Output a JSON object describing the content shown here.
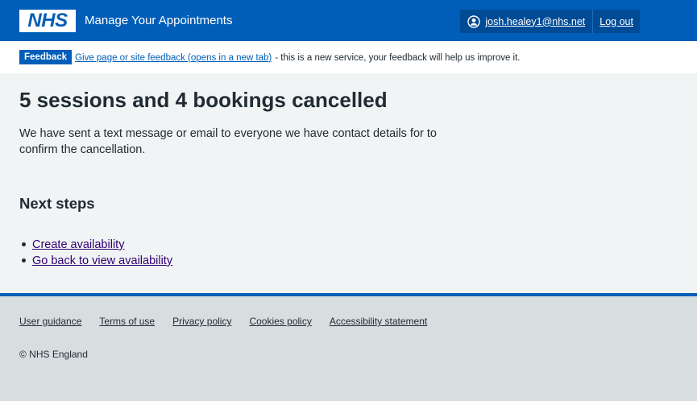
{
  "header": {
    "logo_text": "NHS",
    "service_name": "Manage Your Appointments",
    "user_email": "josh.healey1@nhs.net",
    "logout_label": "Log out",
    "user_icon": "user-circle-icon"
  },
  "feedback": {
    "tag": "Feedback",
    "link": "Give page or site feedback (opens in a new tab)",
    "text": "- this is a new service, your feedback will help us improve it."
  },
  "main": {
    "title": "5 sessions and 4 bookings cancelled",
    "lead": "We have sent a text message or email to everyone we have contact details for to confirm the cancellation.",
    "next_steps_heading": "Next steps",
    "next_steps": [
      "Create availability",
      "Go back to view availability"
    ]
  },
  "footer": {
    "links": [
      "User guidance",
      "Terms of use",
      "Privacy policy",
      "Cookies policy",
      "Accessibility statement"
    ],
    "copyright": "© NHS England"
  },
  "colors": {
    "brand_blue": "#005eb8",
    "link_purple": "#330072",
    "page_bg": "#f0f4f5",
    "footer_bg": "#d8dde0"
  }
}
